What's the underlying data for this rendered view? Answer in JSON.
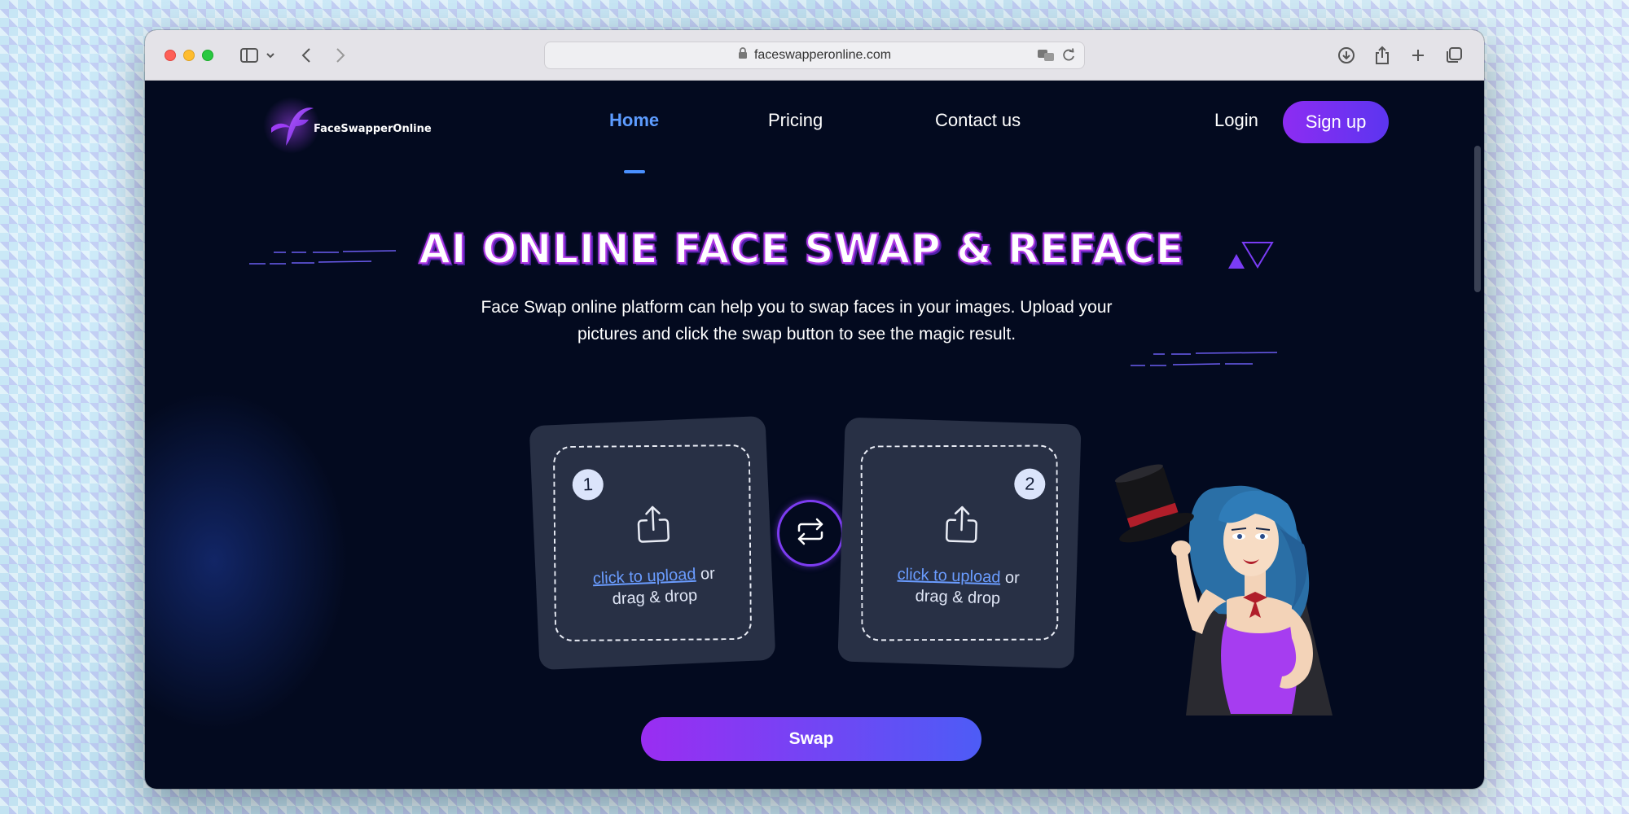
{
  "browser": {
    "url": "faceswapperonline.com"
  },
  "nav": {
    "logo_text": "FaceSwapperOnline",
    "home": "Home",
    "pricing": "Pricing",
    "contact": "Contact us",
    "login": "Login",
    "signup": "Sign up"
  },
  "hero": {
    "title": "AI ONLINE FACE SWAP & REFACE",
    "subtitle": "Face Swap online platform can help you to swap faces in your images. Upload your pictures and click the swap button to see the magic result."
  },
  "uploads": [
    {
      "number": "1",
      "link": "click to upload",
      "or": " or",
      "rest": "drag & drop"
    },
    {
      "number": "2",
      "link": "click to upload",
      "or": " or",
      "rest": "drag & drop"
    }
  ],
  "swap_label": "Swap",
  "colors": {
    "background": "#030a1f",
    "accent_purple": "#8d2cf2",
    "accent_blue": "#4a90ff",
    "card": "#283045"
  },
  "icons": [
    "sidebar-icon",
    "chevron-down-icon",
    "back-icon",
    "forward-icon",
    "lock-icon",
    "translate-icon",
    "reload-icon",
    "download-icon",
    "share-icon",
    "new-tab-icon",
    "tabs-icon",
    "upload-icon",
    "swap-icon"
  ]
}
